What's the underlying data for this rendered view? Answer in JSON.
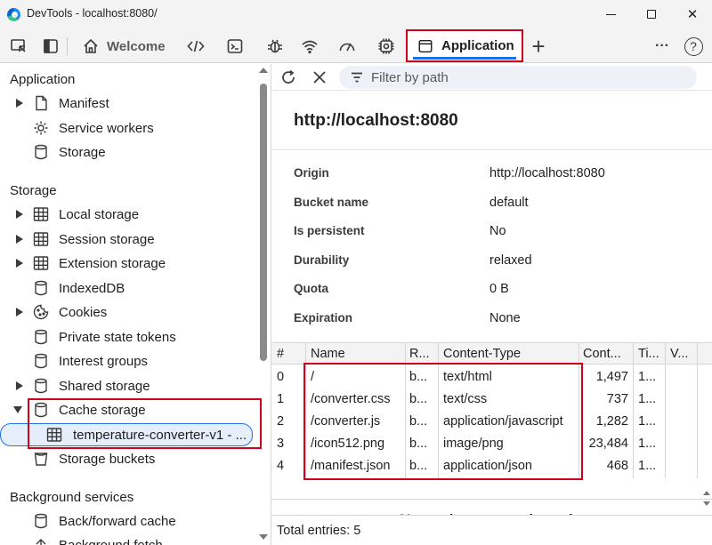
{
  "window": {
    "title": "DevTools - localhost:8080/",
    "minimize": "minimize-icon",
    "maximize": "maximize-icon",
    "close": "✕"
  },
  "toolbar": {
    "tabs": [
      {
        "icon": "home-icon",
        "label": "Welcome"
      },
      {
        "icon": "elements-icon",
        "label": ""
      },
      {
        "icon": "console-icon",
        "label": ""
      },
      {
        "icon": "sources-bug-icon",
        "label": ""
      },
      {
        "icon": "network-wifi-icon",
        "label": ""
      },
      {
        "icon": "performance-gauge-icon",
        "label": ""
      },
      {
        "icon": "memory-chip-icon",
        "label": ""
      },
      {
        "icon": "application-window-icon",
        "label": "Application"
      }
    ],
    "more_tools": "+",
    "more_menu": "···",
    "help": "?"
  },
  "sidebar": {
    "application_heading": "Application",
    "application_items": [
      {
        "label": "Manifest",
        "icon": "document-icon",
        "expandable": true
      },
      {
        "label": "Service workers",
        "icon": "gear-icon",
        "expandable": false
      },
      {
        "label": "Storage",
        "icon": "database-icon",
        "expandable": false
      }
    ],
    "storage_heading": "Storage",
    "storage_items": [
      {
        "label": "Local storage",
        "icon": "grid-icon",
        "expandable": true
      },
      {
        "label": "Session storage",
        "icon": "grid-icon",
        "expandable": true
      },
      {
        "label": "Extension storage",
        "icon": "grid-icon",
        "expandable": true
      },
      {
        "label": "IndexedDB",
        "icon": "database-icon",
        "expandable": false
      },
      {
        "label": "Cookies",
        "icon": "cookie-icon",
        "expandable": true
      },
      {
        "label": "Private state tokens",
        "icon": "database-icon",
        "expandable": false
      },
      {
        "label": "Interest groups",
        "icon": "database-icon",
        "expandable": false
      },
      {
        "label": "Shared storage",
        "icon": "database-icon",
        "expandable": true
      },
      {
        "label": "Cache storage",
        "icon": "database-icon",
        "expanded": true
      },
      {
        "label": "temperature-converter-v1 - ...",
        "icon": "grid-icon",
        "selected": true
      },
      {
        "label": "Storage buckets",
        "icon": "bucket-icon",
        "expandable": false
      }
    ],
    "background_heading": "Background services",
    "background_items": [
      {
        "label": "Back/forward cache",
        "icon": "database-icon"
      },
      {
        "label": "Background fetch",
        "icon": "upload-icon"
      }
    ]
  },
  "main": {
    "filter_placeholder": "Filter by path",
    "origin_title": "http://localhost:8080",
    "details": [
      {
        "key": "Origin",
        "value": "http://localhost:8080"
      },
      {
        "key": "Bucket name",
        "value": "default"
      },
      {
        "key": "Is persistent",
        "value": "No"
      },
      {
        "key": "Durability",
        "value": "relaxed"
      },
      {
        "key": "Quota",
        "value": "0 B"
      },
      {
        "key": "Expiration",
        "value": "None"
      }
    ],
    "table": {
      "columns": [
        "#",
        "Name",
        "R...",
        "Content-Type",
        "Cont...",
        "Ti...",
        "V..."
      ],
      "rows": [
        [
          "0",
          "/",
          "b...",
          "text/html",
          "1,497",
          "1...",
          ""
        ],
        [
          "1",
          "/converter.css",
          "b...",
          "text/css",
          "737",
          "1...",
          ""
        ],
        [
          "2",
          "/converter.js",
          "b...",
          "application/javascript",
          "1,282",
          "1...",
          ""
        ],
        [
          "3",
          "/icon512.png",
          "b...",
          "image/png",
          "23,484",
          "1...",
          ""
        ],
        [
          "4",
          "/manifest.json",
          "b...",
          "application/json",
          "468",
          "1...",
          ""
        ]
      ]
    },
    "empty_preview": "No cache entry selected",
    "status": "Total entries: 5"
  },
  "colors": {
    "highlight": "#d0021b",
    "accent": "#1a73e8",
    "selected_bg": "#e6eefb"
  }
}
